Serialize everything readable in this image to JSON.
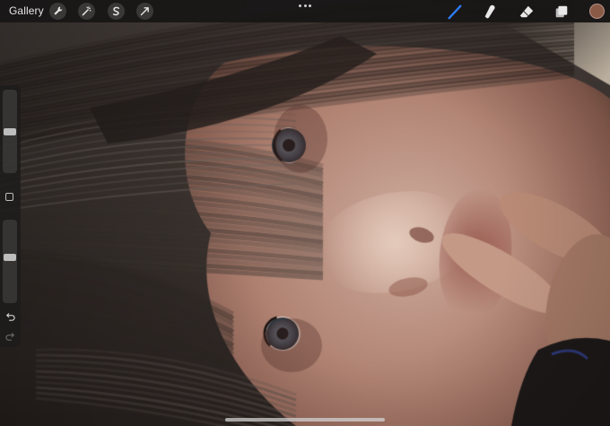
{
  "app": {
    "gallery_label": "Gallery"
  },
  "toolbar": {
    "left_tools": [
      {
        "name": "actions",
        "icon": "wrench-icon"
      },
      {
        "name": "adjustments",
        "icon": "magic-wand-icon"
      },
      {
        "name": "selection",
        "icon": "selection-s-icon"
      },
      {
        "name": "transform",
        "icon": "arrow-cursor-icon"
      }
    ],
    "right_tools": [
      {
        "name": "brush",
        "icon": "brush-icon",
        "active": true
      },
      {
        "name": "smudge",
        "icon": "smudge-icon",
        "active": false
      },
      {
        "name": "eraser",
        "icon": "eraser-icon",
        "active": false
      },
      {
        "name": "layers",
        "icon": "layers-icon",
        "active": false
      }
    ],
    "current_color": "#8a5a47"
  },
  "sidebar": {
    "brush_size_level": 0.5,
    "opacity_level": 0.55
  },
  "colors": {
    "accent": "#2d7df6"
  }
}
